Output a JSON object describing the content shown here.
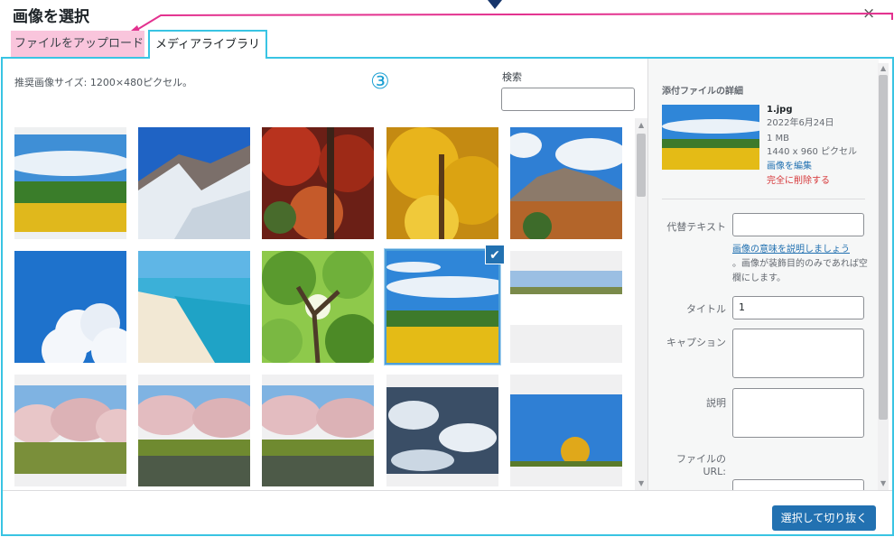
{
  "modal": {
    "title": "画像を選択",
    "close_glyph": "×"
  },
  "annotation": {
    "step_number": "③",
    "accent_color": "#e3328f",
    "frame_color": "#39c4e3"
  },
  "tabs": [
    {
      "label": "ファイルをアップロード",
      "active": false
    },
    {
      "label": "メディアライブラリ",
      "active": true
    }
  ],
  "library": {
    "recommended_size": "推奨画像サイズ: 1200×480ピクセル。",
    "search_label": "検索",
    "search_value": "",
    "items": [
      {
        "icon": "sunflower-field-image"
      },
      {
        "icon": "snowy-mountain-image"
      },
      {
        "icon": "red-autumn-forest-image"
      },
      {
        "icon": "yellow-ginkgo-image"
      },
      {
        "icon": "volcano-autumn-image"
      },
      {
        "icon": "cumulus-cloud-image"
      },
      {
        "icon": "tropical-beach-image"
      },
      {
        "icon": "green-tree-canopy-image"
      },
      {
        "icon": "sunflower-field-image",
        "selected": true,
        "check_glyph": "✔"
      },
      {
        "icon": "wide-landscape-strip-image"
      },
      {
        "icon": "cherry-blossom-row-image"
      },
      {
        "icon": "cherry-blossom-river-image"
      },
      {
        "icon": "cherry-blossom-river-image"
      },
      {
        "icon": "snowy-stream-image"
      },
      {
        "icon": "ginkgo-tree-sky-image"
      }
    ]
  },
  "attachment": {
    "heading": "添付ファイルの詳細",
    "filename": "1.jpg",
    "date": "2022年6月24日",
    "size": "1 MB",
    "dimensions": "1440 x 960 ピクセル",
    "edit_link": "画像を編集",
    "delete_link": "完全に削除する",
    "fields": {
      "alt_label": "代替テキスト",
      "alt_value": "",
      "alt_help_link": "画像の意味を説明しましょう",
      "alt_help_text": "。画像が装飾目的のみであれば空欄にします。",
      "title_label": "タイトル",
      "title_value": "1",
      "caption_label": "キャプション",
      "description_label": "説明",
      "url_label": "ファイルの\nURL:"
    }
  },
  "footer": {
    "select_crop_button": "選択して切り抜く",
    "button_color": "#2271b1"
  }
}
